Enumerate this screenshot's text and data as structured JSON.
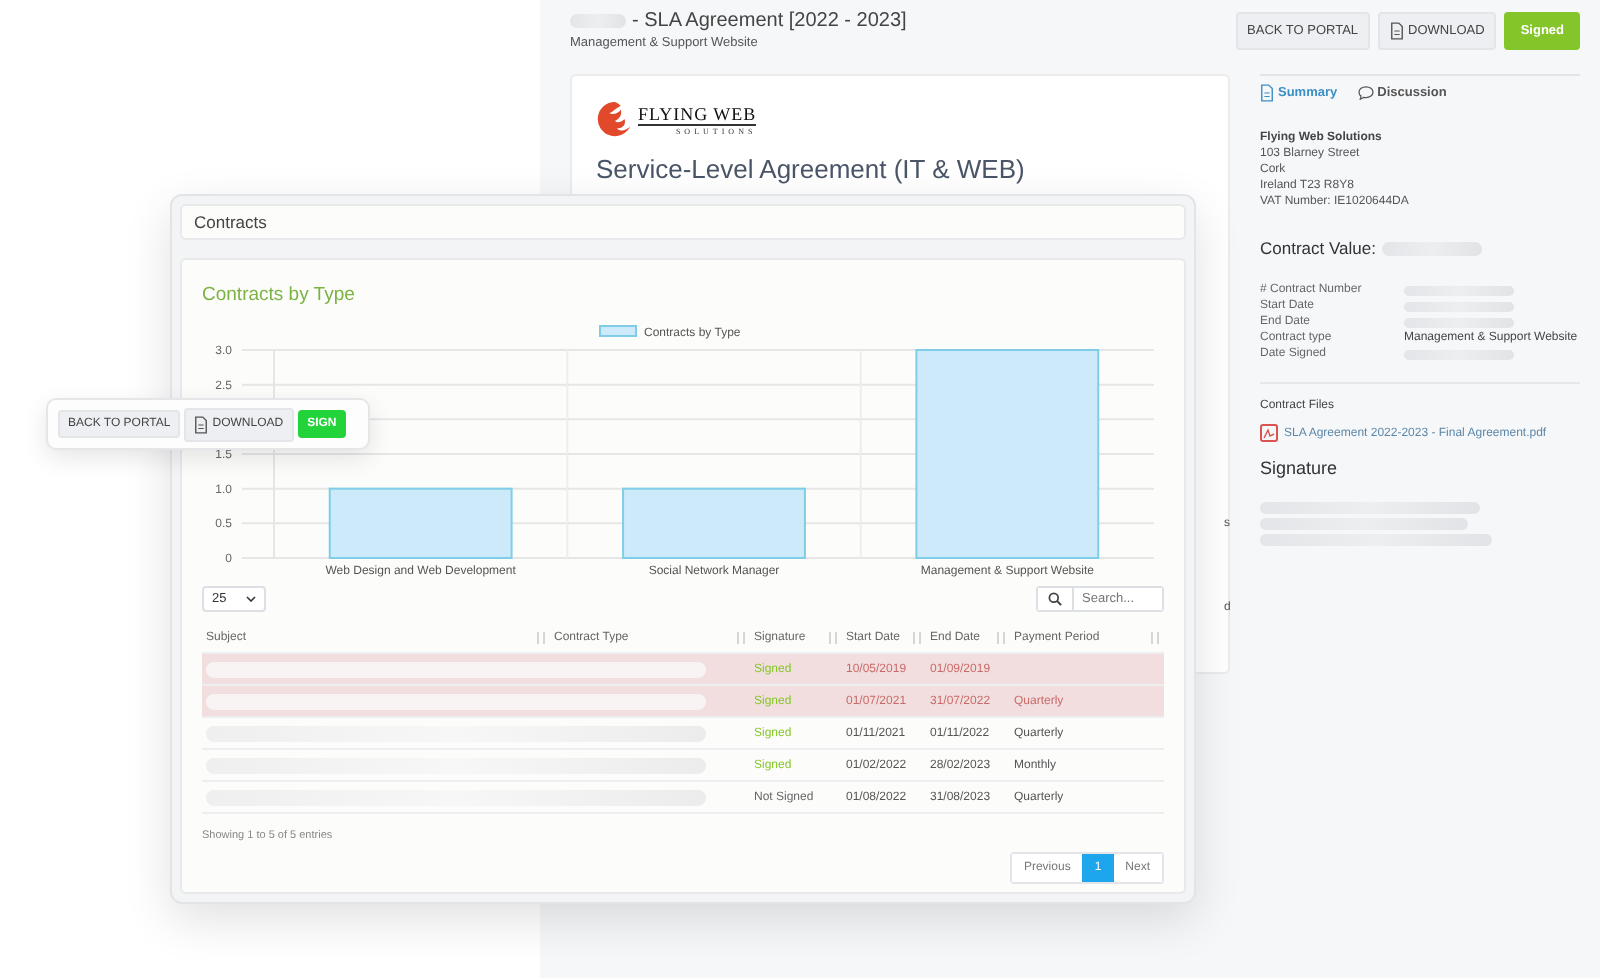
{
  "background_page": {
    "title": "- SLA Agreement [2022 - 2023]",
    "subtitle": "Management & Support Website",
    "buttons": [
      {
        "label": "BACK TO PORTAL",
        "kind": "plain"
      },
      {
        "label": "DOWNLOAD",
        "kind": "download"
      },
      {
        "label": "Signed",
        "kind": "primary"
      }
    ],
    "document": {
      "logo_name": "FLYING WEB",
      "logo_tagline": "SOLUTIONS",
      "heading": "Service-Level Agreement (IT & WEB)",
      "text_fragments": [
        "s",
        "d"
      ]
    },
    "tabs": [
      {
        "label": "Summary",
        "selected": true,
        "kind": "summary"
      },
      {
        "label": "Discussion",
        "selected": false,
        "kind": "discussion"
      }
    ],
    "company": {
      "name": "Flying Web Solutions",
      "lines": [
        "103 Blarney Street",
        "Cork",
        "Ireland T23 R8Y8",
        "VAT Number: IE1020644DA"
      ]
    },
    "contract_value_label": "Contract Value:",
    "fields": [
      {
        "label": "# Contract Number"
      },
      {
        "label": "Start Date"
      },
      {
        "label": "End Date"
      },
      {
        "label": "Contract type",
        "value": "Management & Support Website"
      },
      {
        "label": "Date Signed"
      }
    ],
    "files_heading": "Contract Files",
    "file": "SLA Agreement 2022-2023 - Final Agreement.pdf",
    "signature_heading": "Signature"
  },
  "contracts_panel": {
    "title": "Contracts",
    "chart_title": "Contracts by Type",
    "chart_data": {
      "type": "bar",
      "categories": [
        "Web Design and Web Development",
        "Social Network Manager",
        "Management & Support Website"
      ],
      "series": [
        {
          "name": "Contracts by Type",
          "color": "#cdeafb",
          "values": [
            1,
            1,
            3
          ]
        }
      ],
      "ylim": [
        0,
        3
      ],
      "grid": true,
      "yticks": [
        {
          "value": 0,
          "label": "0"
        },
        {
          "value": 0.5,
          "label": "0.5"
        },
        {
          "value": 1,
          "label": "1.0"
        },
        {
          "value": 1.5,
          "label": "1.5"
        },
        {
          "value": 2.5,
          "label": "2.5"
        },
        {
          "value": 3,
          "label": "3.0"
        }
      ]
    },
    "page_size": "25",
    "search_placeholder": "Search...",
    "columns": [
      "Subject",
      "Contract Type",
      "Signature",
      "Start Date",
      "End Date",
      "Payment Period"
    ],
    "rows": [
      {
        "signature": "Signed",
        "signed": true,
        "start": "10/05/2019",
        "end": "01/09/2019",
        "expired": true
      },
      {
        "signature": "Signed",
        "signed": true,
        "start": "01/07/2021",
        "end": "31/07/2022",
        "period": "Quarterly",
        "expired": true
      },
      {
        "signature": "Signed",
        "signed": true,
        "start": "01/11/2021",
        "end": "01/11/2022",
        "period": "Quarterly",
        "expired": false
      },
      {
        "signature": "Signed",
        "signed": true,
        "start": "01/02/2022",
        "end": "28/02/2023",
        "period": "Monthly",
        "expired": false
      },
      {
        "signature": "Not Signed",
        "signed": false,
        "start": "01/08/2022",
        "end": "31/08/2023",
        "period": "Quarterly",
        "expired": false
      }
    ],
    "info": "Showing 1 to 5 of 5 entries",
    "pagination": [
      {
        "label": "Previous",
        "selected": false
      },
      {
        "label": "1",
        "selected": true
      },
      {
        "label": "Next",
        "selected": false
      }
    ]
  },
  "floating_toolbar": {
    "buttons": [
      {
        "label": "BACK TO PORTAL",
        "kind": "plain"
      },
      {
        "label": "DOWNLOAD",
        "kind": "download"
      },
      {
        "label": "SIGN",
        "kind": "sign"
      }
    ]
  }
}
